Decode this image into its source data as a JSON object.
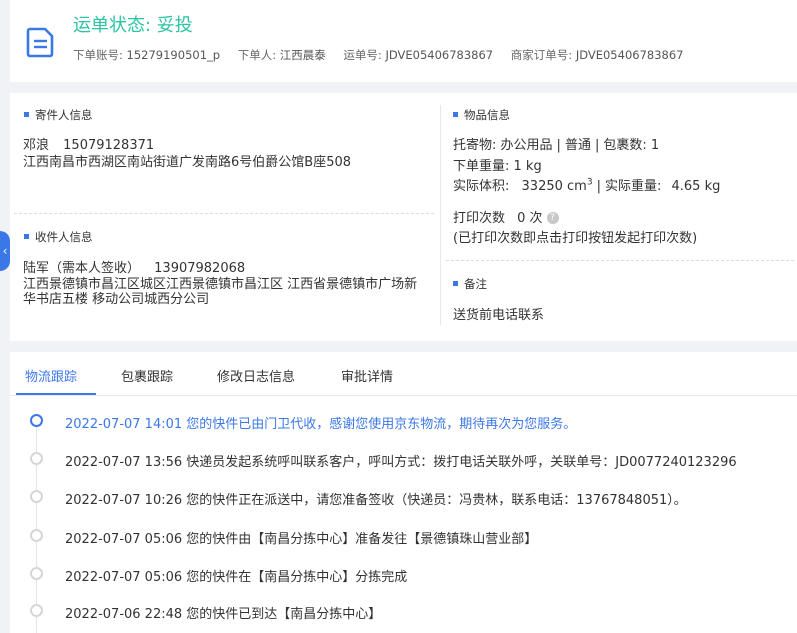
{
  "header": {
    "status": "运单状态: 妥投",
    "order_account_label": "下单账号:",
    "order_account": "15279190501_p",
    "orderer_label": "下单人:",
    "orderer": "江西晨泰",
    "waybill_label": "运单号:",
    "waybill": "JDVE05406783867",
    "merchant_order_label": "商家订单号:",
    "merchant_order": "JDVE05406783867"
  },
  "sender": {
    "title": "寄件人信息",
    "name": "邓浪",
    "phone": "15079128371",
    "address": "江西南昌市西湖区南站街道广发南路6号伯爵公馆B座508"
  },
  "receiver": {
    "title": "收件人信息",
    "name": "陆军（需本人签收）",
    "phone": "13907982068",
    "address": "江西景德镇市昌江区城区江西景德镇市昌江区 江西省景德镇市广场新华书店五楼 移动公司城西分公司"
  },
  "goods": {
    "title": "物品信息",
    "item_label": "托寄物:",
    "item": "办公用品",
    "service": "普通",
    "packages_label": "包裹数:",
    "packages": "1",
    "order_weight_label": "下单重量:",
    "order_weight": "1 kg",
    "volume_label": "实际体积:",
    "volume": "33250 cm",
    "volume_sup": "3",
    "actual_weight_label": "实际重量:",
    "actual_weight": "4.65 kg",
    "print_label": "打印次数",
    "print_count": "0 次",
    "print_hint": "(已打印次数即点击打印按钮发起打印次数)"
  },
  "remark": {
    "title": "备注",
    "text": "送货前电话联系"
  },
  "tabs": [
    "物流跟踪",
    "包裹跟踪",
    "修改日志信息",
    "审批详情"
  ],
  "events": [
    "2022-07-07 14:01 您的快件已由门卫代收，感谢您使用京东物流，期待再次为您服务。",
    "2022-07-07 13:56 快递员发起系统呼叫联系客户，呼叫方式：拨打电话关联外呼，关联单号：JD0077240123296",
    "2022-07-07 10:26 您的快件正在派送中，请您准备签收（快递员：冯贵林，联系电话：13767848051）。",
    "2022-07-07 05:06 您的快件由【南昌分拣中心】准备发往【景德镇珠山营业部】",
    "2022-07-07 05:06 您的快件在【南昌分拣中心】分拣完成",
    "2022-07-06 22:48 您的快件已到达【南昌分拣中心】"
  ],
  "colors": {
    "status": "#2bc3a4",
    "accent": "#3b78e7"
  }
}
